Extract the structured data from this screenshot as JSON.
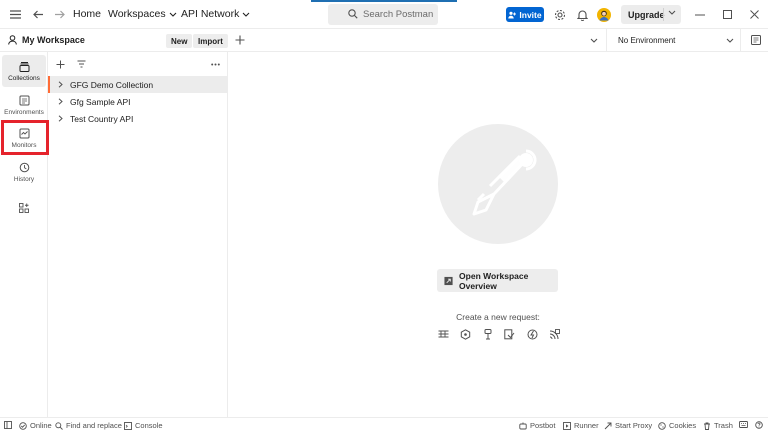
{
  "topbar": {
    "home": "Home",
    "workspaces": "Workspaces",
    "api_network": "API Network",
    "search_placeholder": "Search Postman",
    "invite": "Invite",
    "upgrade": "Upgrade"
  },
  "workspace": {
    "title": "My Workspace",
    "new_label": "New",
    "import_label": "Import"
  },
  "rail": {
    "items": [
      {
        "label": "Collections",
        "icon": "collections-icon",
        "active": true
      },
      {
        "label": "Environments",
        "icon": "environments-icon"
      },
      {
        "label": "Monitors",
        "icon": "monitors-icon"
      },
      {
        "label": "History",
        "icon": "history-icon"
      },
      {
        "label": "",
        "icon": "configure-sidebar-icon"
      }
    ]
  },
  "collections": [
    {
      "name": "GFG Demo Collection",
      "selected": true
    },
    {
      "name": "Gfg Sample API"
    },
    {
      "name": "Test Country API"
    }
  ],
  "environment": {
    "selected": "No Environment"
  },
  "main": {
    "overview_button": "Open Workspace Overview",
    "create_label": "Create a new request:",
    "request_types": [
      "http-icon",
      "graphql-icon",
      "grpc-icon",
      "websocket-icon",
      "socketio-icon",
      "mqtt-icon"
    ]
  },
  "statusbar": {
    "online": "Online",
    "find_replace": "Find and replace",
    "console": "Console",
    "postbot": "Postbot",
    "runner": "Runner",
    "start_proxy": "Start Proxy",
    "cookies": "Cookies",
    "trash": "Trash"
  },
  "colors": {
    "accent": "#ff6c37",
    "invite_blue": "#0265d2",
    "highlight_red": "#e5232c"
  }
}
